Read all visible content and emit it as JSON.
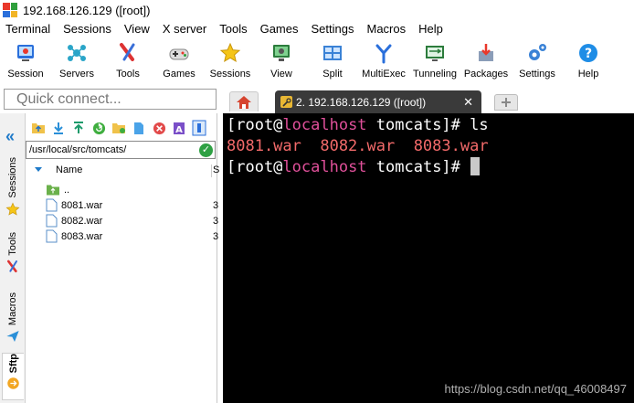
{
  "window": {
    "title": "192.168.126.129 ([root])"
  },
  "menu": [
    "Terminal",
    "Sessions",
    "View",
    "X server",
    "Tools",
    "Games",
    "Settings",
    "Macros",
    "Help"
  ],
  "toolbar": [
    {
      "label": "Session",
      "icon": "session-icon"
    },
    {
      "label": "Servers",
      "icon": "servers-icon"
    },
    {
      "label": "Tools",
      "icon": "tools-icon"
    },
    {
      "label": "Games",
      "icon": "games-icon"
    },
    {
      "label": "Sessions",
      "icon": "star-icon"
    },
    {
      "label": "View",
      "icon": "view-icon"
    },
    {
      "label": "Split",
      "icon": "split-icon"
    },
    {
      "label": "MultiExec",
      "icon": "multiexec-icon"
    },
    {
      "label": "Tunneling",
      "icon": "tunneling-icon"
    },
    {
      "label": "Packages",
      "icon": "packages-icon"
    },
    {
      "label": "Settings",
      "icon": "settings-icon"
    },
    {
      "label": "Help",
      "icon": "help-icon"
    }
  ],
  "quick_connect": {
    "placeholder": "Quick connect..."
  },
  "tabs": {
    "active_label": "2. 192.168.126.129 ([root])",
    "close": "✕"
  },
  "side_tabs": [
    "Sessions",
    "Tools",
    "Macros",
    "Sftp"
  ],
  "sftp": {
    "path": "/usr/local/src/tomcats/",
    "column_name": "Name",
    "column_size": "S",
    "entries": [
      {
        "name": "..",
        "type": "folder",
        "trail": ""
      },
      {
        "name": "8081.war",
        "type": "file",
        "trail": "3"
      },
      {
        "name": "8082.war",
        "type": "file",
        "trail": "3"
      },
      {
        "name": "8083.war",
        "type": "file",
        "trail": "3"
      }
    ]
  },
  "terminal": {
    "line1": {
      "user": "[root@",
      "host": "localhost",
      "rest": " tomcats]# ls"
    },
    "line2": {
      "files": "8081.war  8082.war  8083.war"
    },
    "line3": {
      "user": "[root@",
      "host": "localhost",
      "rest": " tomcats]# "
    }
  },
  "watermark": "https://blog.csdn.net/qq_46008497",
  "colors": {
    "terminal_bg": "#000000",
    "host": "#e0509a",
    "war_files": "#f26a6a",
    "tab_active": "#3a3a3a"
  }
}
